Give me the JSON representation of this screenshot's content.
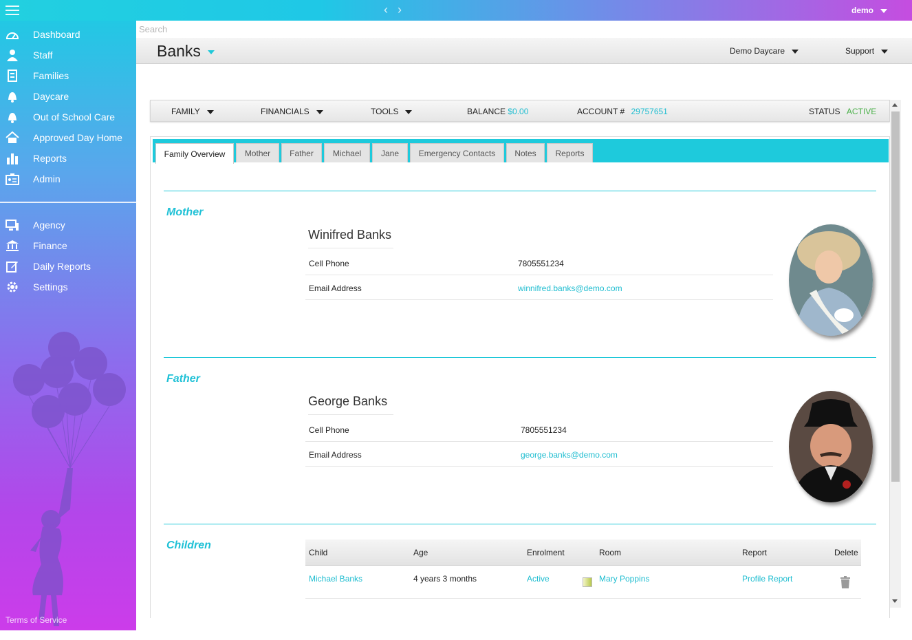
{
  "topbar": {
    "user": "demo",
    "nav_back": "‹",
    "nav_forward": "›"
  },
  "sidebar": {
    "items": [
      {
        "label": "Dashboard",
        "icon": "dashboard-icon"
      },
      {
        "label": "Staff",
        "icon": "person-icon"
      },
      {
        "label": "Families",
        "icon": "families-icon"
      },
      {
        "label": "Daycare",
        "icon": "bell-icon"
      },
      {
        "label": "Out of School Care",
        "icon": "bell-icon"
      },
      {
        "label": "Approved Day Home",
        "icon": "home-icon"
      },
      {
        "label": "Reports",
        "icon": "bar-chart-icon"
      },
      {
        "label": "Admin",
        "icon": "admin-icon"
      }
    ],
    "items2": [
      {
        "label": "Agency",
        "icon": "monitor-icon"
      },
      {
        "label": "Finance",
        "icon": "bank-icon"
      },
      {
        "label": "Daily Reports",
        "icon": "edit-icon"
      },
      {
        "label": "Settings",
        "icon": "gear-icon"
      }
    ],
    "terms": "Terms of Service"
  },
  "search": {
    "placeholder": "Search"
  },
  "header": {
    "title": "Banks",
    "daycare": "Demo Daycare",
    "support": "Support"
  },
  "account_bar": {
    "family": "FAMILY",
    "financials": "FINANCIALS",
    "tools": "TOOLS",
    "balance_label": "BALANCE",
    "balance_value": "$0.00",
    "account_label": "ACCOUNT #",
    "account_value": "29757651",
    "status_label": "STATUS",
    "status_value": "ACTIVE"
  },
  "tabs": [
    "Family Overview",
    "Mother",
    "Father",
    "Michael",
    "Jane",
    "Emergency Contacts",
    "Notes",
    "Reports"
  ],
  "mother": {
    "section": "Mother",
    "name": "Winifred Banks",
    "cell_label": "Cell Phone",
    "cell": "7805551234",
    "email_label": "Email Address",
    "email": "winnifred.banks@demo.com"
  },
  "father": {
    "section": "Father",
    "name": "George Banks",
    "cell_label": "Cell Phone",
    "cell": "7805551234",
    "email_label": "Email Address",
    "email": "george.banks@demo.com"
  },
  "children": {
    "section": "Children",
    "headers": {
      "child": "Child",
      "age": "Age",
      "enrolment": "Enrolment",
      "room": "Room",
      "report": "Report",
      "delete": "Delete"
    },
    "rows": [
      {
        "child": "Michael Banks",
        "age": "4 years 3 months",
        "enrolment": "Active",
        "room": "Mary Poppins",
        "report": "Profile Report"
      }
    ]
  },
  "colors": {
    "accent": "#1fc8d9",
    "active_status": "#4bb04a"
  }
}
